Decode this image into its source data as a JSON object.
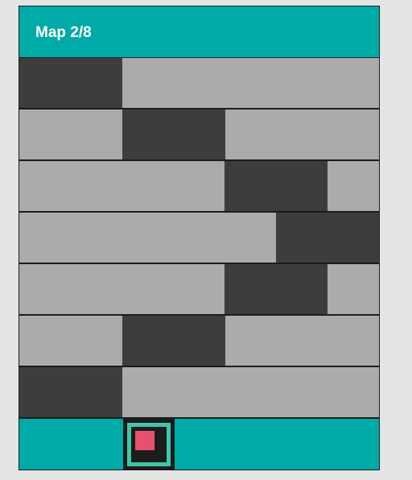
{
  "header": {
    "title": "Map 2/8"
  },
  "colors": {
    "background": "#e4e4e4",
    "header": "#00aaa7",
    "lane": "#ababab",
    "obstacle": "#3d3d3d",
    "border": "#1c1c1c",
    "player_ring": "#3fc7a6",
    "player_core": "#e8506f"
  },
  "grid": {
    "columns": 7,
    "obstacle_rows": [
      {
        "obstacle_columns": [
          1,
          2
        ]
      },
      {
        "obstacle_columns": [
          3,
          4
        ]
      },
      {
        "obstacle_columns": [
          5,
          6
        ]
      },
      {
        "obstacle_columns": [
          6,
          7
        ]
      },
      {
        "obstacle_columns": [
          5,
          6
        ]
      },
      {
        "obstacle_columns": [
          3,
          4
        ]
      },
      {
        "obstacle_columns": [
          1,
          2
        ]
      }
    ]
  },
  "player": {
    "column": 3,
    "icon": "player-marker-icon"
  }
}
